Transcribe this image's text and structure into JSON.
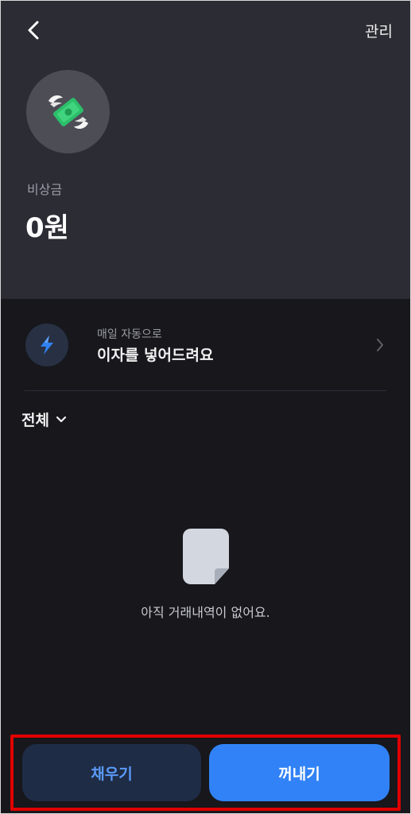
{
  "header": {
    "manage_label": "관리",
    "account_label": "비상금",
    "balance": "0원",
    "back_icon": "chevron-left-icon",
    "avatar_icon": "winged-money-icon"
  },
  "promo": {
    "subtitle": "매일 자동으로",
    "title": "이자를 넣어드려요",
    "icon": "lightning-icon"
  },
  "filter": {
    "label": "전체",
    "icon": "chevron-down-icon"
  },
  "empty_state": {
    "message": "아직 거래내역이 없어요.",
    "icon": "document-icon"
  },
  "actions": {
    "fill_label": "채우기",
    "withdraw_label": "꺼내기"
  },
  "colors": {
    "header_bg": "#2c2c34",
    "page_bg": "#17171c",
    "primary": "#3182f6",
    "secondary_bg": "#1f2c45",
    "secondary_text": "#5a9af8",
    "highlight": "#e00000"
  }
}
